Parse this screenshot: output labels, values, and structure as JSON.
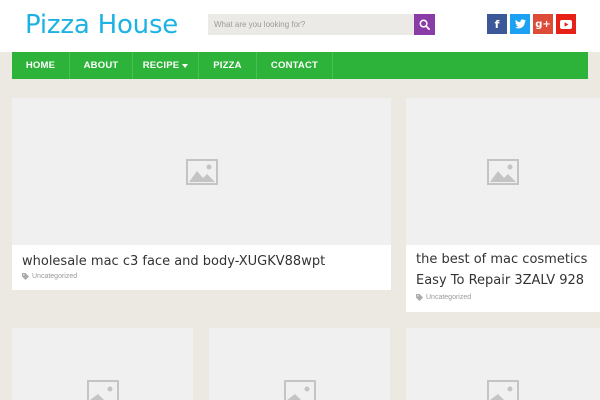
{
  "site": {
    "title": "Pizza House"
  },
  "search": {
    "placeholder": "What are you looking for?"
  },
  "social": [
    {
      "icon": "facebook-icon",
      "glyph": "f",
      "color": "#3b5998"
    },
    {
      "icon": "twitter-icon",
      "glyph": "t",
      "color": "#1da1f2"
    },
    {
      "icon": "google-plus-icon",
      "glyph": "g+",
      "color": "#dd4b39"
    },
    {
      "icon": "youtube-icon",
      "glyph": "▶",
      "color": "#e62117"
    }
  ],
  "nav": {
    "items": [
      {
        "label": "HOME"
      },
      {
        "label": "ABOUT"
      },
      {
        "label": "RECIPE",
        "has_dropdown": true
      },
      {
        "label": "PIZZA"
      },
      {
        "label": "CONTACT"
      }
    ]
  },
  "posts": [
    {
      "title": "wholesale mac c3 face and body-XUGKV88wpt",
      "category": "Uncategorized"
    },
    {
      "title_line1": "the best of mac cosmetics",
      "title_line2": "Easy To Repair 3ZALV 928",
      "category": "Uncategorized"
    }
  ],
  "colors": {
    "brand": "#1cb3e4",
    "nav_bg": "#2db33a",
    "search_button": "#8a3ca6"
  }
}
